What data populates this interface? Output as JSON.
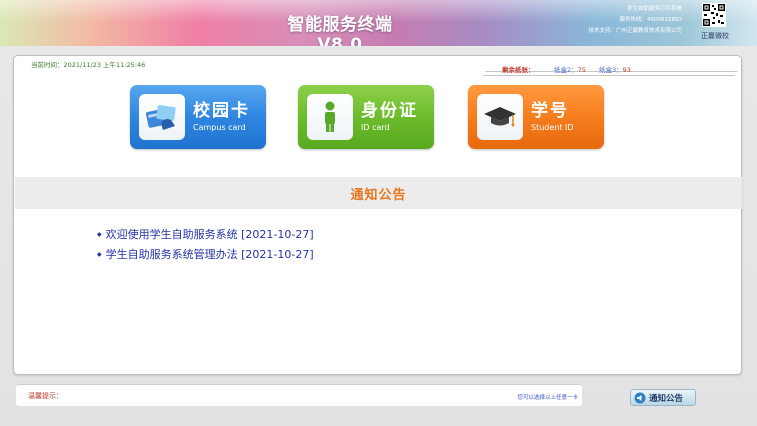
{
  "header": {
    "title": "智能服务终端 V8.0",
    "info_line1": "学生自助服务打印系统",
    "info_line2": "服务热线：4000815893",
    "info_line3": "技术支持：广州正赢教育技术有限公司",
    "qr_label": "正赢微校"
  },
  "status": {
    "time": "当前时间：2021/11/23 上午11:25:46",
    "paper_label": "剩余纸张：",
    "paper_box2_label": "纸盒2：",
    "paper_box2_value": "75",
    "paper_box3_label": "纸盒3：",
    "paper_box3_value": "93"
  },
  "buttons": {
    "campus": {
      "zh": "校园卡",
      "en": "Campus card"
    },
    "idcard": {
      "zh": "身份证",
      "en": "ID card"
    },
    "student": {
      "zh": "学号",
      "en": "Student ID"
    }
  },
  "notice": {
    "title": "通知公告",
    "items": [
      {
        "text": "欢迎使用学生自助服务系统 [2021-10-27]"
      },
      {
        "text": "学生自助服务系统管理办法 [2021-10-27]"
      }
    ]
  },
  "footer": {
    "tip_label": "温馨提示：",
    "tip_right": "您可以选择以上任意一卡",
    "notice_button": "通知公告"
  },
  "colors": {
    "blue": "#2f86e0",
    "green": "#6cbc2c",
    "orange": "#f57d1d",
    "notice_title": "#e8761c",
    "link": "#2433a8"
  }
}
